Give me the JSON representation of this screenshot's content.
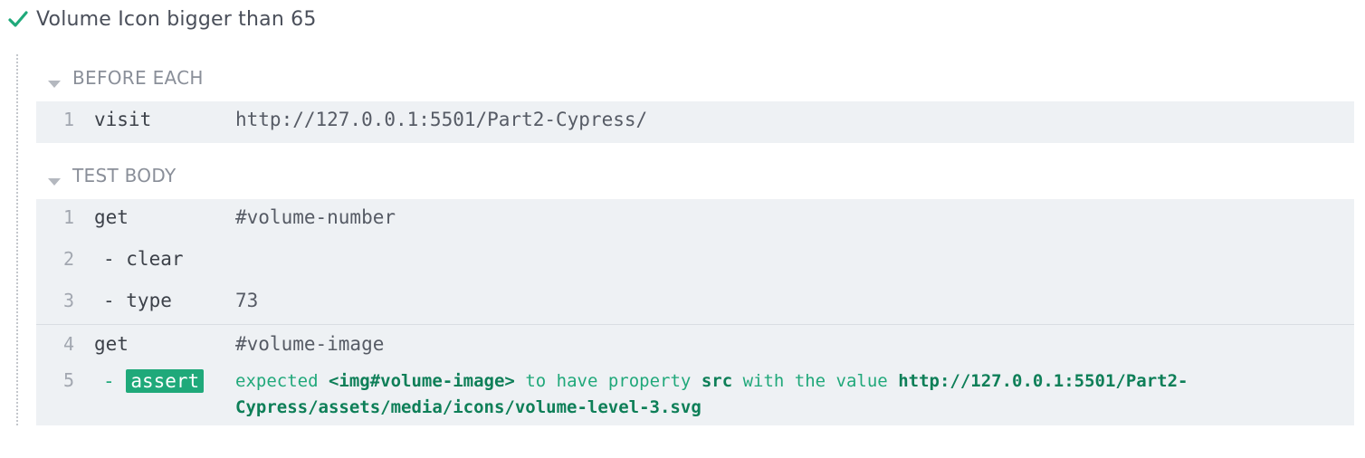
{
  "test": {
    "title": "Volume Icon bigger than 65",
    "status_icon": "check-icon",
    "status_color": "#1fa97a"
  },
  "before_each": {
    "label": "BEFORE EACH",
    "commands": [
      {
        "num": "1",
        "name": "visit",
        "message": "http://127.0.0.1:5501/Part2-Cypress/"
      }
    ]
  },
  "test_body": {
    "label": "TEST BODY",
    "commands": [
      {
        "num": "1",
        "name": "get",
        "message": "#volume-number"
      },
      {
        "num": "2",
        "name": "- clear",
        "message": ""
      },
      {
        "num": "3",
        "name": "- type",
        "message": "73"
      },
      {
        "num": "4",
        "name": "get",
        "message": "#volume-image"
      },
      {
        "num": "5",
        "name_prefix": "-",
        "name": "assert",
        "message": {
          "expected": "expected",
          "subject": "<img#volume-image>",
          "to_have_property": "to have property",
          "property": "src",
          "with_the_value": "with the value",
          "value_line1": "http://127.0.0.1:5501/Part2-",
          "value_line2": "Cypress/assets/media/icons/volume-level-3.svg"
        }
      }
    ]
  },
  "colors": {
    "passed": "#1fa97a",
    "command_bg": "#eef1f4",
    "hook_label": "#8a8f99"
  }
}
